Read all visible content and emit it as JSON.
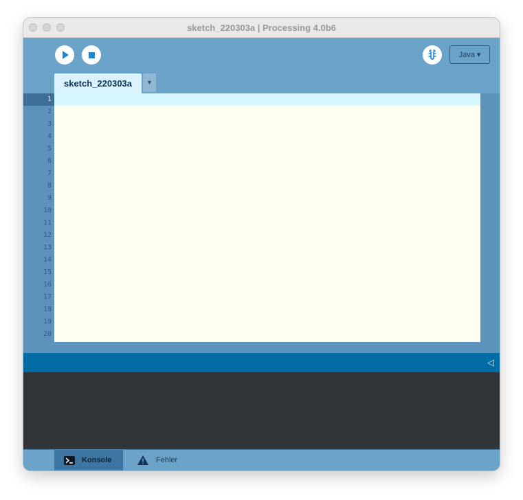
{
  "window": {
    "title": "sketch_220303a | Processing 4.0b6"
  },
  "toolbar": {
    "run_icon": "play-icon",
    "stop_icon": "stop-icon",
    "debug_icon": "debugger-icon",
    "mode_label": "Java ▾"
  },
  "tabs": [
    {
      "label": "sketch_220303a",
      "active": true
    }
  ],
  "tab_menu_label": "▾",
  "editor": {
    "line_numbers": [
      "1",
      "2",
      "3",
      "4",
      "5",
      "6",
      "7",
      "8",
      "9",
      "10",
      "11",
      "12",
      "13",
      "14",
      "15",
      "16",
      "17",
      "18",
      "19",
      "20"
    ],
    "current_line": 1,
    "code": ""
  },
  "status": {
    "collapse_label": "◁"
  },
  "bottom_tabs": [
    {
      "label": "Konsole",
      "icon": "terminal-icon",
      "active": true
    },
    {
      "label": "Fehler",
      "icon": "warning-icon",
      "active": false
    }
  ],
  "colors": {
    "toolbar_bg": "#6ba2c8",
    "editor_bg": "#fefff0",
    "current_line_bg": "#d7f7ff",
    "status_bg": "#016ca4",
    "console_bg": "#313438",
    "accent": "#1b87d6"
  }
}
